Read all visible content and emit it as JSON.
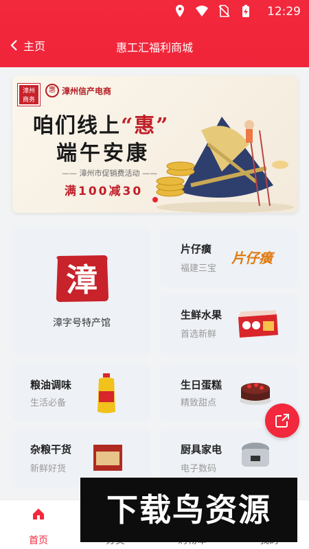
{
  "status_bar": {
    "time": "12:29",
    "icons": [
      "location-icon",
      "wifi-icon",
      "no-sim-icon",
      "battery-charging-icon"
    ]
  },
  "header": {
    "back_label": "主页",
    "title": "惠工汇福利商城"
  },
  "banner": {
    "stamp_text": "漳州商务",
    "brand": "漳州信产电商",
    "line1_prefix": "咱们线上",
    "line1_highlight": "“惠”",
    "line2": "端午安康",
    "subtitle": "—— 漳州市促销费活动 ——",
    "offer": "满100减30"
  },
  "featured": {
    "label": "漳字号特产馆",
    "seal_char": "漳"
  },
  "categories": [
    {
      "title": "片仔癀",
      "subtitle": "福建三宝",
      "image": "pianzaihuang-logo"
    },
    {
      "title": "生鲜水果",
      "subtitle": "首选新鲜",
      "image": "fruit-box"
    },
    {
      "title": "粮油调味",
      "subtitle": "生活必备",
      "image": "oil-bottle"
    },
    {
      "title": "生日蛋糕",
      "subtitle": "精致甜点",
      "image": "cake"
    },
    {
      "title": "杂粮干货",
      "subtitle": "新鲜好货",
      "image": "dry-goods-pack"
    },
    {
      "title": "厨具家电",
      "subtitle": "电子数码",
      "image": "rice-cooker"
    }
  ],
  "bottom_nav": [
    {
      "label": "首页",
      "icon": "home-icon",
      "active": true
    },
    {
      "label": "分类",
      "icon": "category-icon",
      "active": false
    },
    {
      "label": "购物车",
      "icon": "cart-icon",
      "active": false
    },
    {
      "label": "我的",
      "icon": "profile-icon",
      "active": false
    }
  ],
  "watermark": "下载鸟资源",
  "colors": {
    "brand_red": "#f2283c",
    "card_bg": "#eef1f6"
  }
}
